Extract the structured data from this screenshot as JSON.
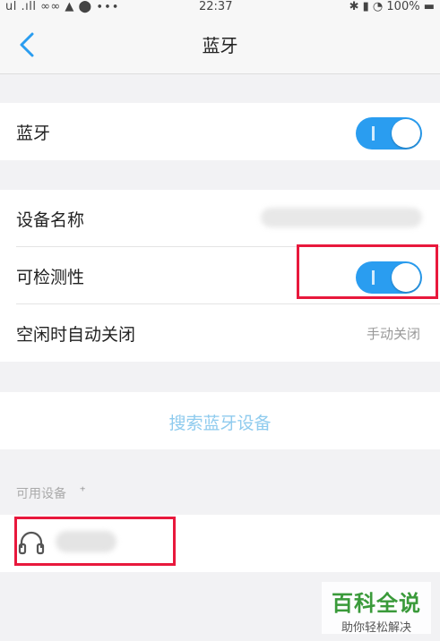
{
  "status_bar": {
    "carrier": "ul .ıll ∞∞ ▲ ⬤ ∙∙∙",
    "time": "22:37",
    "right": "✱ ▮ ◔ 100% ▬"
  },
  "nav": {
    "title": "蓝牙"
  },
  "bluetooth": {
    "label": "蓝牙",
    "enabled": true
  },
  "device": {
    "name_label": "设备名称",
    "visibility_label": "可检测性",
    "visibility_enabled": true,
    "idle_label": "空闲时自动关闭",
    "idle_value": "手动关闭"
  },
  "search": {
    "label": "搜索蓝牙设备"
  },
  "available": {
    "header": "可用设备",
    "spinner": "⁺"
  },
  "colors": {
    "toggle_on": "#2a9df0",
    "highlight": "#e8183c",
    "link": "#8fcbee"
  },
  "watermark": {
    "main": "百科全说",
    "sub": "助你轻松解决"
  }
}
